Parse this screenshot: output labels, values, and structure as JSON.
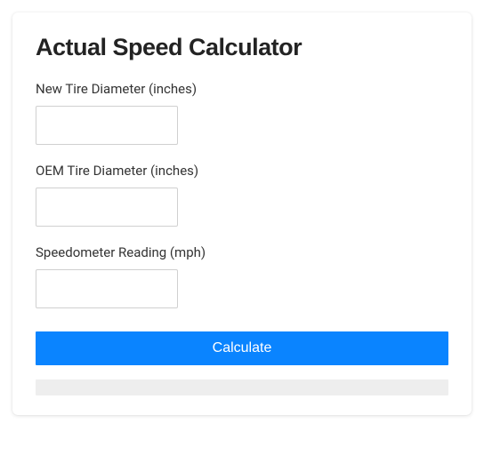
{
  "title": "Actual Speed Calculator",
  "fields": {
    "newTire": {
      "label": "New Tire Diameter (inches)",
      "value": ""
    },
    "oemTire": {
      "label": "OEM Tire Diameter (inches)",
      "value": ""
    },
    "speedometer": {
      "label": "Speedometer Reading (mph)",
      "value": ""
    }
  },
  "buttons": {
    "calculate": "Calculate"
  },
  "result": ""
}
